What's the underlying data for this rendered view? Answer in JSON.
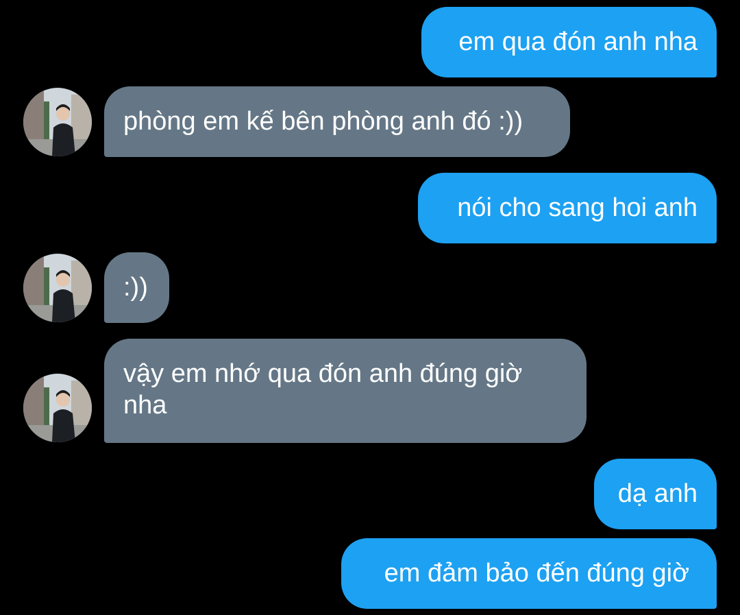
{
  "conversation": {
    "messages": [
      {
        "side": "sent",
        "text": "em qua đón anh nha"
      },
      {
        "side": "received",
        "text": "phòng em kế bên phòng anh đó :))"
      },
      {
        "side": "sent",
        "text": "nói cho sang hoi anh"
      },
      {
        "side": "received",
        "text": ":))"
      },
      {
        "side": "received",
        "text": "vậy em nhớ qua đón anh đúng giờ nha"
      },
      {
        "side": "sent",
        "text": "dạ anh"
      },
      {
        "side": "sent",
        "text": "em đảm bảo đến đúng giờ"
      }
    ]
  },
  "colors": {
    "background": "#000000",
    "sent_bubble": "#1da1f2",
    "received_bubble": "#657786",
    "text": "#ffffff"
  }
}
